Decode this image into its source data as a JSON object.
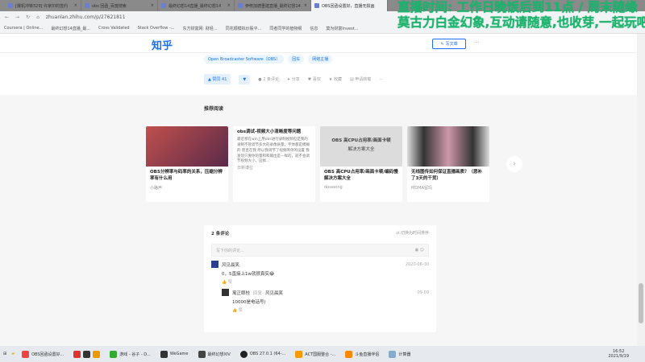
{
  "browser": {
    "tabs": [
      "[爆机冲锋329] 许家印的签约",
      "obs 回函_百度搜索",
      "最终幻想14直播_最终幻想14",
      "伊修加德重建直播_最终幻想14",
      "OBS回函设置好，直播无损画"
    ],
    "url": "zhuanlan.zhihu.com/p/27621811",
    "bookmarks": [
      "Coursera | Online...",
      "最终幻想14直播_最...",
      "Cross Validated",
      "Stack Overflow -...",
      "东方财富网: 财经...",
      "同花顺模拟炒股平...",
      "同者同学的植物纲",
      "信息",
      "莫为财富Invest..."
    ]
  },
  "header": {
    "logo": "知乎",
    "write_label": "写文章",
    "more": "···"
  },
  "article": {
    "tags": [
      "Open Broadcaster Software（OBS）",
      "回车",
      "网络主播"
    ],
    "vote_label": "▲ 赞同 41",
    "down": "▼",
    "comments": "2 条评论",
    "share": "分享",
    "like": "喜欢",
    "collect": "收藏",
    "repost": "申请转载",
    "more": "···"
  },
  "recommend": {
    "title": "推荐阅读",
    "cards": [
      {
        "title": "OBS分辨率与码率的关系，压缩分辨率有什么用",
        "author": "小路声",
        "img": "#8a3a3a"
      },
      {
        "title": "obs调试-视频大小清晰度等问题",
        "desc": "最近想在win上用obs进行录制视频但是我的录制不管调节多大的录像质量，字体都是模糊的 而且在我 所以我调节了视频简单的设置 我发现只要你的量和和输出是一样的，就不会调节视频大小，这样...",
        "author": "日新博拉"
      },
      {
        "title": "OBS 高CPU占用率/画面卡顿/编码慢解决方案大全",
        "img_text1": "OBS 高CPU占用率/画面卡顿",
        "img_text2": "解决方案大全",
        "author": "doseeing",
        "img": "#dcdcdc"
      },
      {
        "title": "无线图传如何保证直播画质？（恶补了3天的干货）",
        "author": "MOMA留玛",
        "img": "#555"
      }
    ]
  },
  "comments": {
    "title": "2 条评论",
    "sort": "⇄ 切换为时间排序",
    "placeholder": "写下你的评论...",
    "items": [
      {
        "user": "风见晨笑",
        "date": "2020-06-30",
        "text": "0，5直接上1w就很真实😂",
        "like": "👍 赞"
      },
      {
        "user": "寓正眼桂",
        "reply": "回复",
        "to": "风见晨笑",
        "date": "09-09",
        "text": "10000是电话号)",
        "like": "👍 赞"
      }
    ]
  },
  "taskbar": {
    "items": [
      "OBS回函设置好...",
      "游戏 - 谷子 - D...",
      "WeGame",
      "最终幻想XIV",
      "OBS 27.0.1 (64-...",
      "ACT国服整合 -...",
      "斗鱼直播伴侣",
      "计算器"
    ],
    "time": "16:52",
    "date": "2021/9/19"
  },
  "overlay": {
    "line1": "直播时间: 工作日晚饭后到11点 / 周末随缘",
    "line2": "莫古力白金幻象,互动请随意,也收芽,一起玩吧"
  }
}
